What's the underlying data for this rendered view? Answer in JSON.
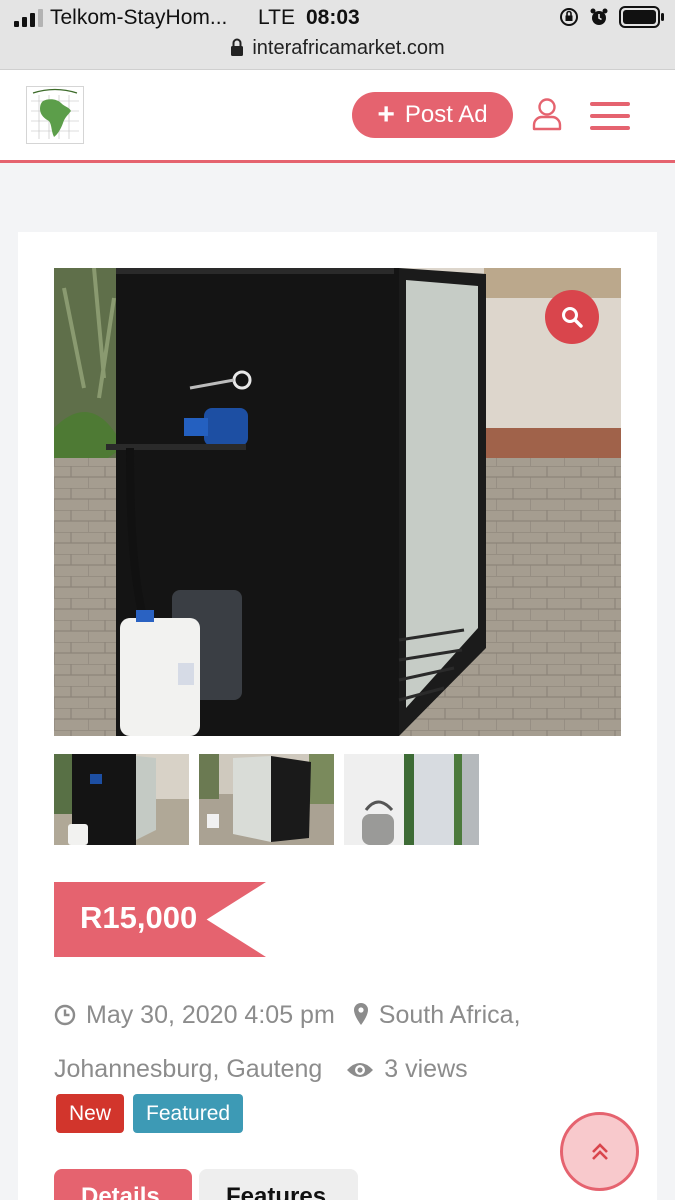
{
  "status_bar": {
    "carrier": "Telkom-StayHom...",
    "network": "LTE",
    "time": "08:03",
    "url": "interafricamarket.com",
    "icons": [
      "signal-icon",
      "lock-icon",
      "orientation-lock-icon",
      "alarm-icon",
      "battery-icon"
    ]
  },
  "header": {
    "logo_text": "INTER AFRICAMARKET",
    "post_ad_label": "Post Ad",
    "icons": [
      "plus-icon",
      "user-icon",
      "hamburger-menu-icon"
    ],
    "accent": "#e5636f"
  },
  "listing": {
    "price": "R15,000",
    "date": "May 30, 2020 4:05 pm",
    "location_line1": "South Africa,",
    "location_line2": "Johannesburg, Gauteng",
    "views": "3 views",
    "badges": {
      "new": "New",
      "featured": "Featured"
    },
    "tabs": {
      "details": "Details",
      "features": "Features"
    },
    "photo_count": 3
  },
  "colors": {
    "accent": "#e5636f",
    "new_badge": "#d2352c",
    "featured_badge": "#3d9ab5",
    "zoom_button": "#d9454c"
  }
}
